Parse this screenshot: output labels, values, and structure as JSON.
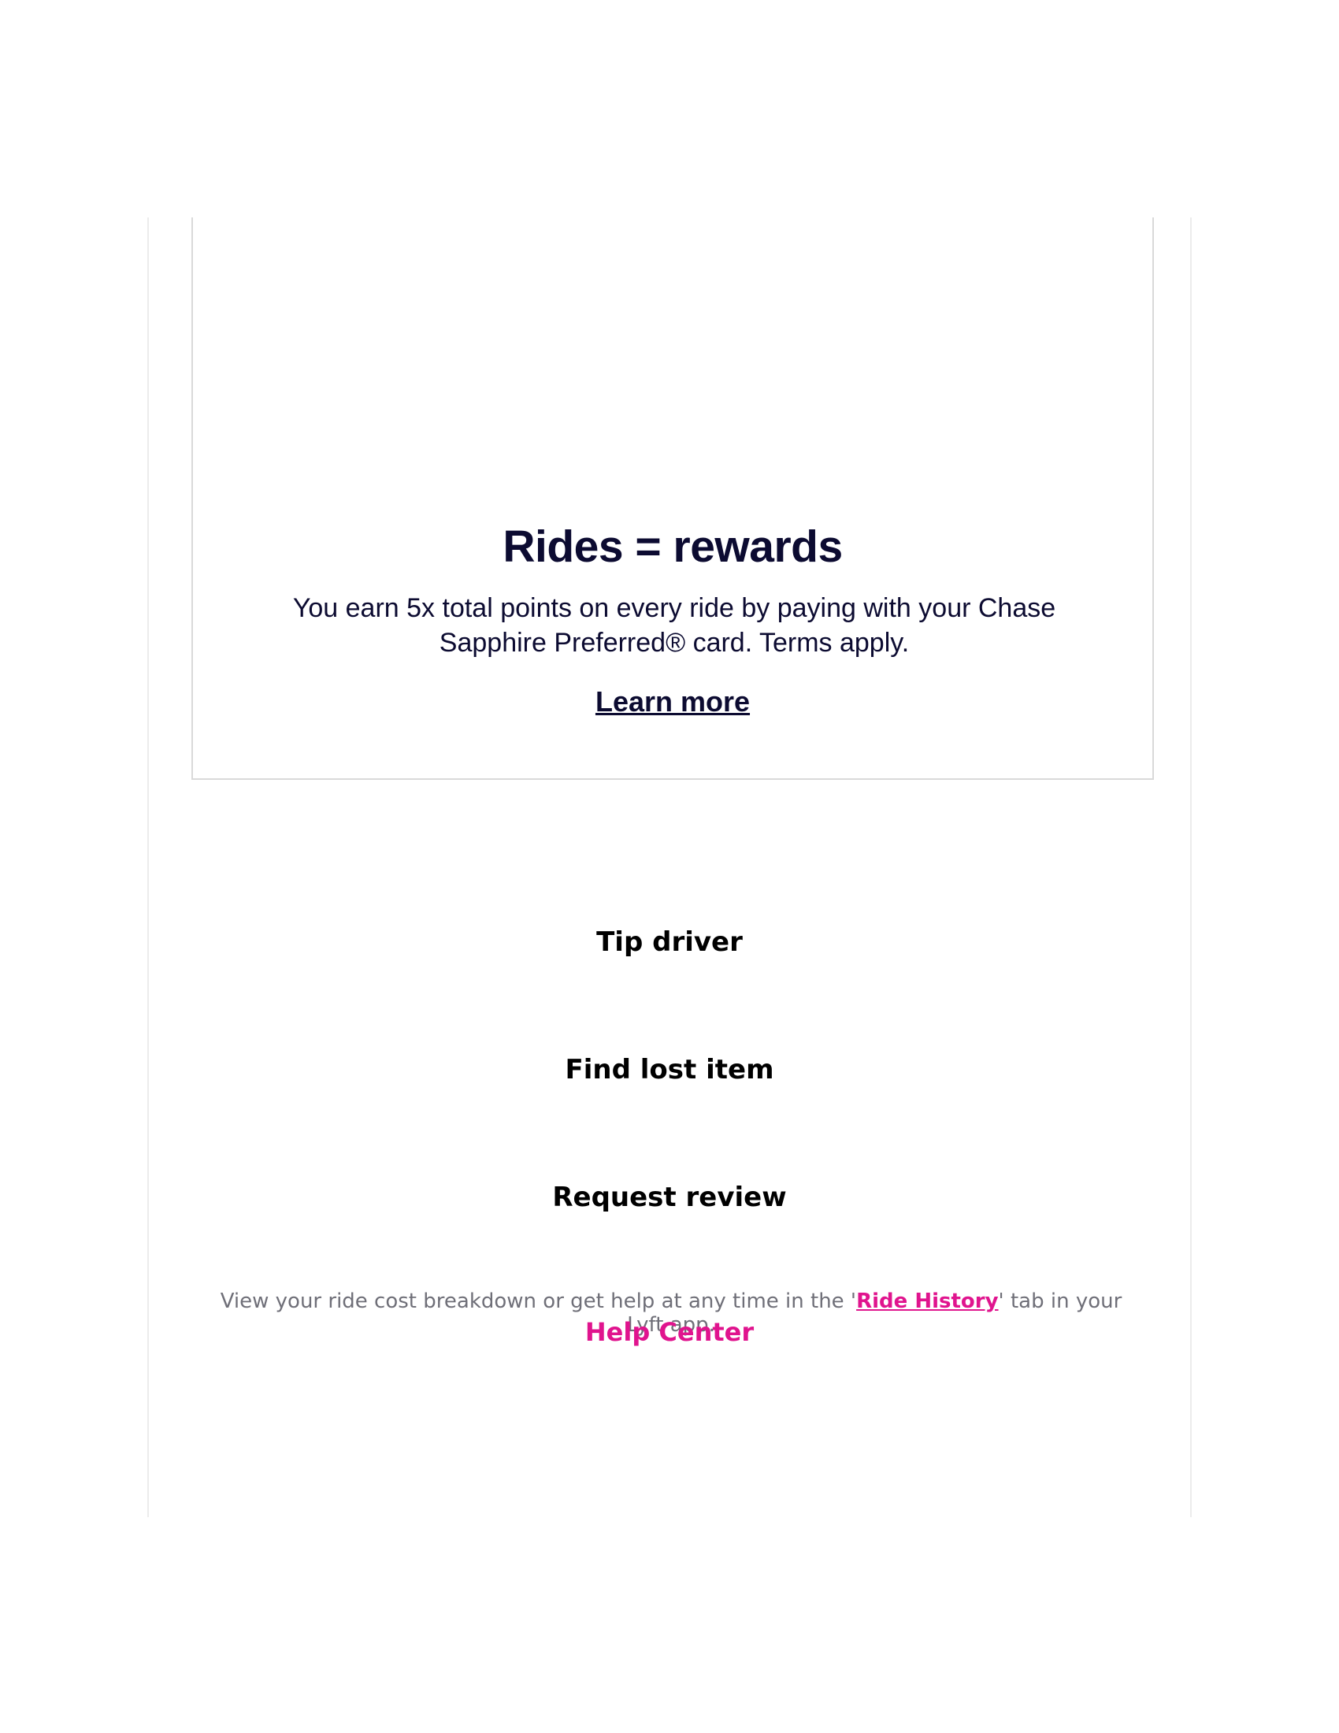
{
  "promo": {
    "title": "Rides = rewards",
    "body": "You earn 5x total points on every ride by paying with your Chase Sapphire Preferred® card. Terms apply.",
    "link_label": "Learn more"
  },
  "actions": {
    "tip_driver": "Tip driver",
    "find_lost_item": "Find lost item",
    "request_review": "Request review"
  },
  "footer": {
    "note_before": "View your ride cost breakdown or get help at any time in the '",
    "ride_history_link": "Ride History",
    "note_after": "' tab in your Lyft app.",
    "help_center": "Help Center"
  },
  "colors": {
    "navy_text": "#0c0b31",
    "brand_pink": "#e0148e",
    "muted_text": "#6f6f78"
  }
}
